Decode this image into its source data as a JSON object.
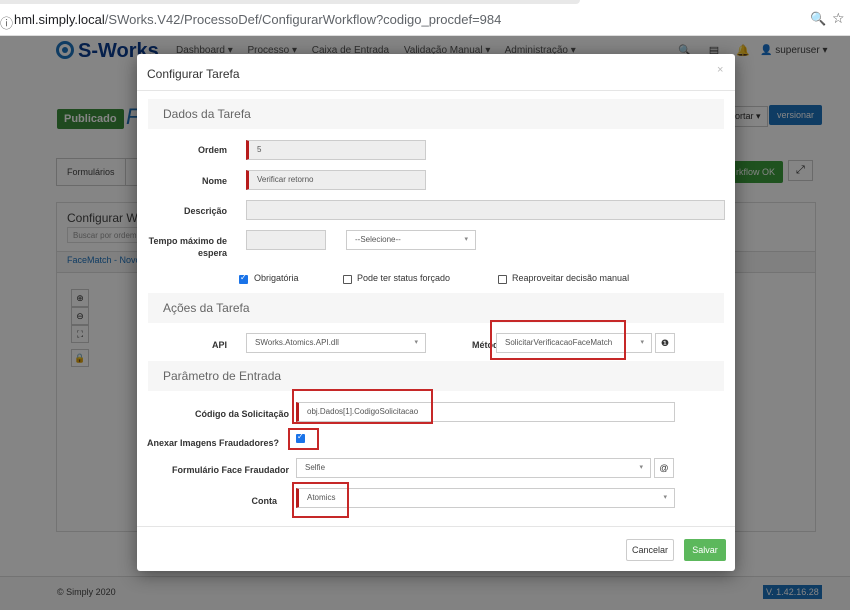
{
  "browser": {
    "info_icon": "ⓘ",
    "url_host": "hml.simply.local",
    "url_path": "/SWorks.V42/ProcessoDef/ConfigurarWorkflow?codigo_procdef=984",
    "zoom_icon": "🔍",
    "star_icon": "☆"
  },
  "app": {
    "logo_text": "S-Works",
    "menu": [
      "Dashboard ▾",
      "Processo ▾",
      "Caixa de Entrada",
      "Validação Manual ▾",
      "Administração ▾"
    ],
    "nav_icons": [
      "🔍",
      "▤",
      "🔔"
    ],
    "user": "superuser ▾",
    "status_badge": "Publicado",
    "page_title": "F",
    "btn_exportar": "ortar ▾",
    "btn_versionar": "versionar",
    "tab_formularios": "Formulários",
    "btn_workflow_ok": "rkflow OK",
    "expand_icon": "⤢",
    "panel_title": "Configurar Wo",
    "panel_search": "Buscar por ordem",
    "panel_link": "FaceMatch - Novo",
    "tools": [
      "⊕",
      "⊖",
      "⛶",
      "🔒"
    ],
    "footer_copy": "© Simply 2020",
    "footer_version": "V. 1.42.16.28"
  },
  "modal": {
    "title": "Configurar Tarefa",
    "close": "×",
    "sections": {
      "dados": "Dados da Tarefa",
      "acoes": "Ações da Tarefa",
      "parametro": "Parâmetro de Entrada"
    },
    "ordem": {
      "label": "Ordem",
      "value": "5"
    },
    "nome": {
      "label": "Nome",
      "value": "Verificar retorno"
    },
    "descricao": {
      "label": "Descrição",
      "value": ""
    },
    "tempo": {
      "label": "Tempo máximo de espera",
      "value": "",
      "select": "--Selecione--"
    },
    "checks": {
      "obrigatoria": "Obrigatória",
      "status_forcado": "Pode ter status forçado",
      "reaproveitar": "Reaproveitar decisão manual"
    },
    "api": {
      "label": "API",
      "value": "SWorks.Atomics.API.dll"
    },
    "metodo": {
      "label": "Método",
      "value": "SolicitarVerificacaoFaceMatch",
      "info_icon": "❶"
    },
    "codigo": {
      "label": "Código da Solicitação",
      "value": "obj.Dados[1].CodigoSolicitacao"
    },
    "anexar": {
      "label": "Anexar Imagens Fraudadores?"
    },
    "formulario": {
      "label": "Formulário Face Fraudador",
      "value": "Selfie",
      "icon": "@"
    },
    "conta": {
      "label": "Conta",
      "value": "Atomics"
    },
    "caret": "▾",
    "btn_cancel": "Cancelar",
    "btn_save": "Salvar"
  }
}
